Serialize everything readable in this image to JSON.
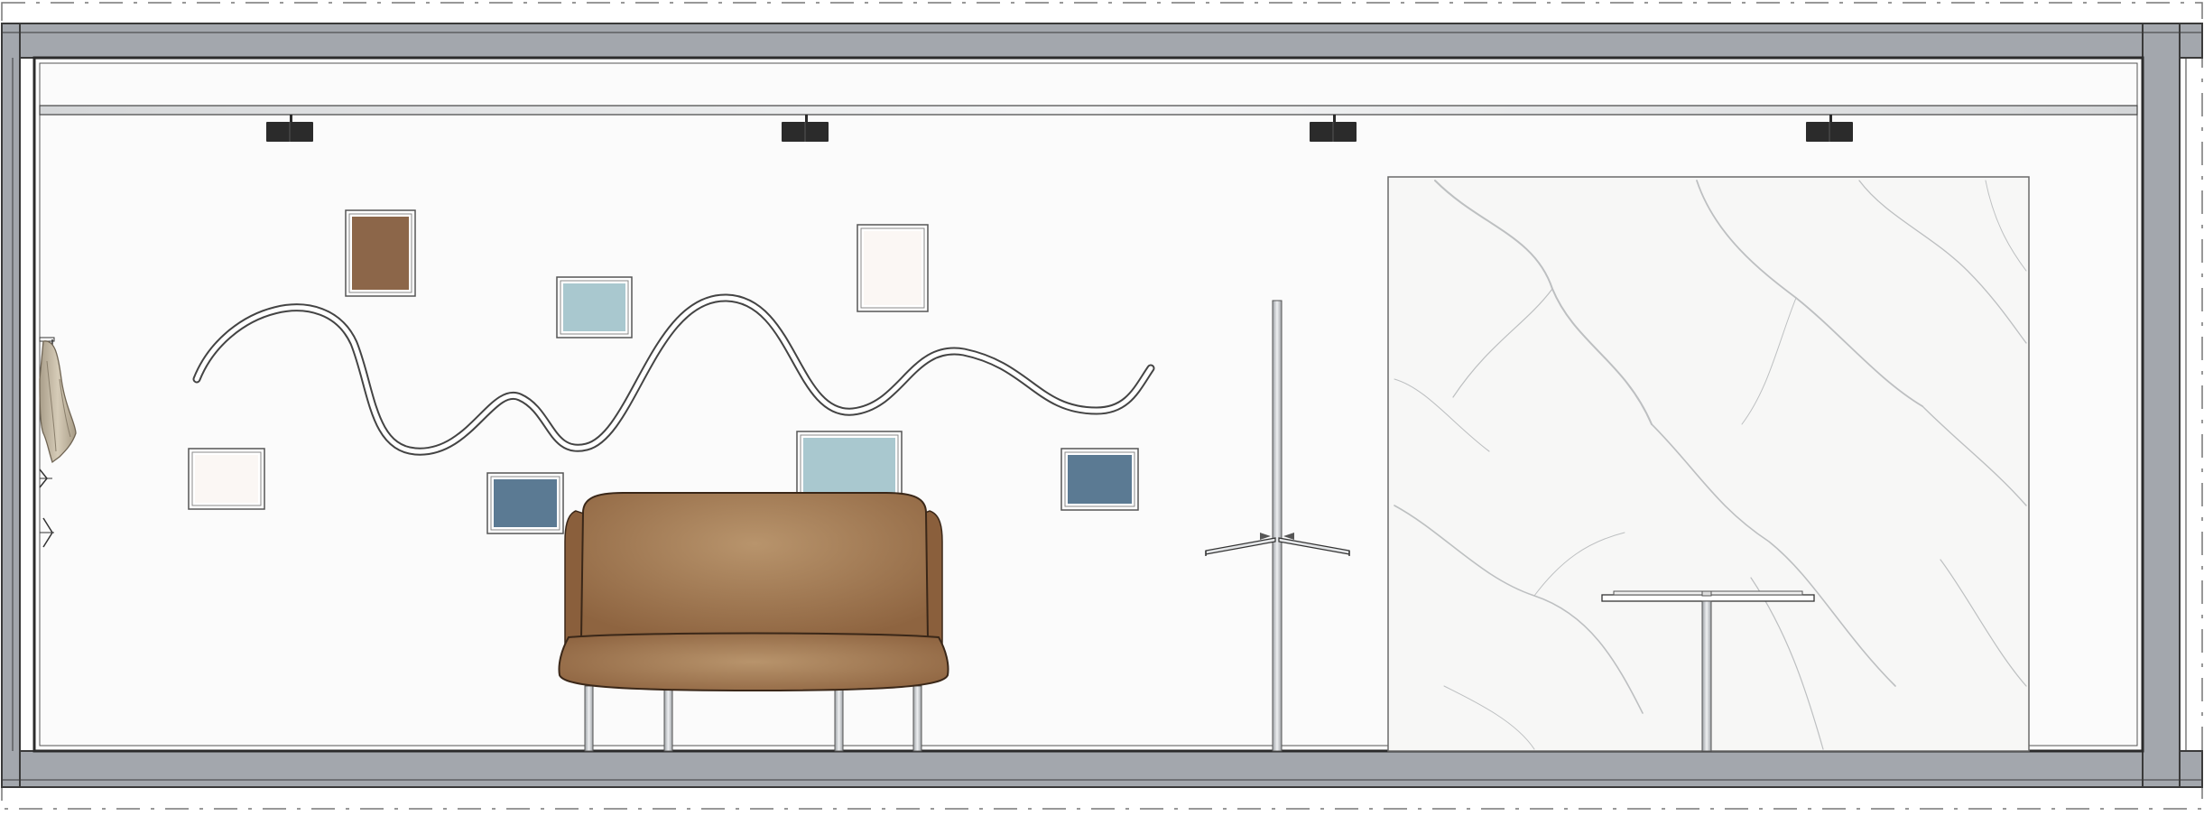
{
  "drawing": {
    "type": "interior-elevation",
    "view": "wall elevation",
    "colors": {
      "wall": "#fbfbfb",
      "structure": "#a3a7ad",
      "structure_edge": "#3a3a3a",
      "track_light": "#2b2b2b",
      "frame_brown": "#8c6649",
      "frame_lightblue": "#a9c8cf",
      "frame_white": "#fbf7f4",
      "frame_darkblue": "#5b7a93",
      "sofa": "#9a6b45",
      "sofa_highlight": "#b8946c",
      "steel": "#c9cccf",
      "marble_vein": "#8e9396"
    },
    "elements": {
      "track_lights": 4,
      "picture_frames": 8,
      "wave_sculpture": "sculpture-wave",
      "sofa": "sofa",
      "coat_stand": "coat-stand",
      "marble_panel": "marble-panel",
      "side_table": "side-table",
      "hanging_garment": "hanging-garment"
    }
  }
}
